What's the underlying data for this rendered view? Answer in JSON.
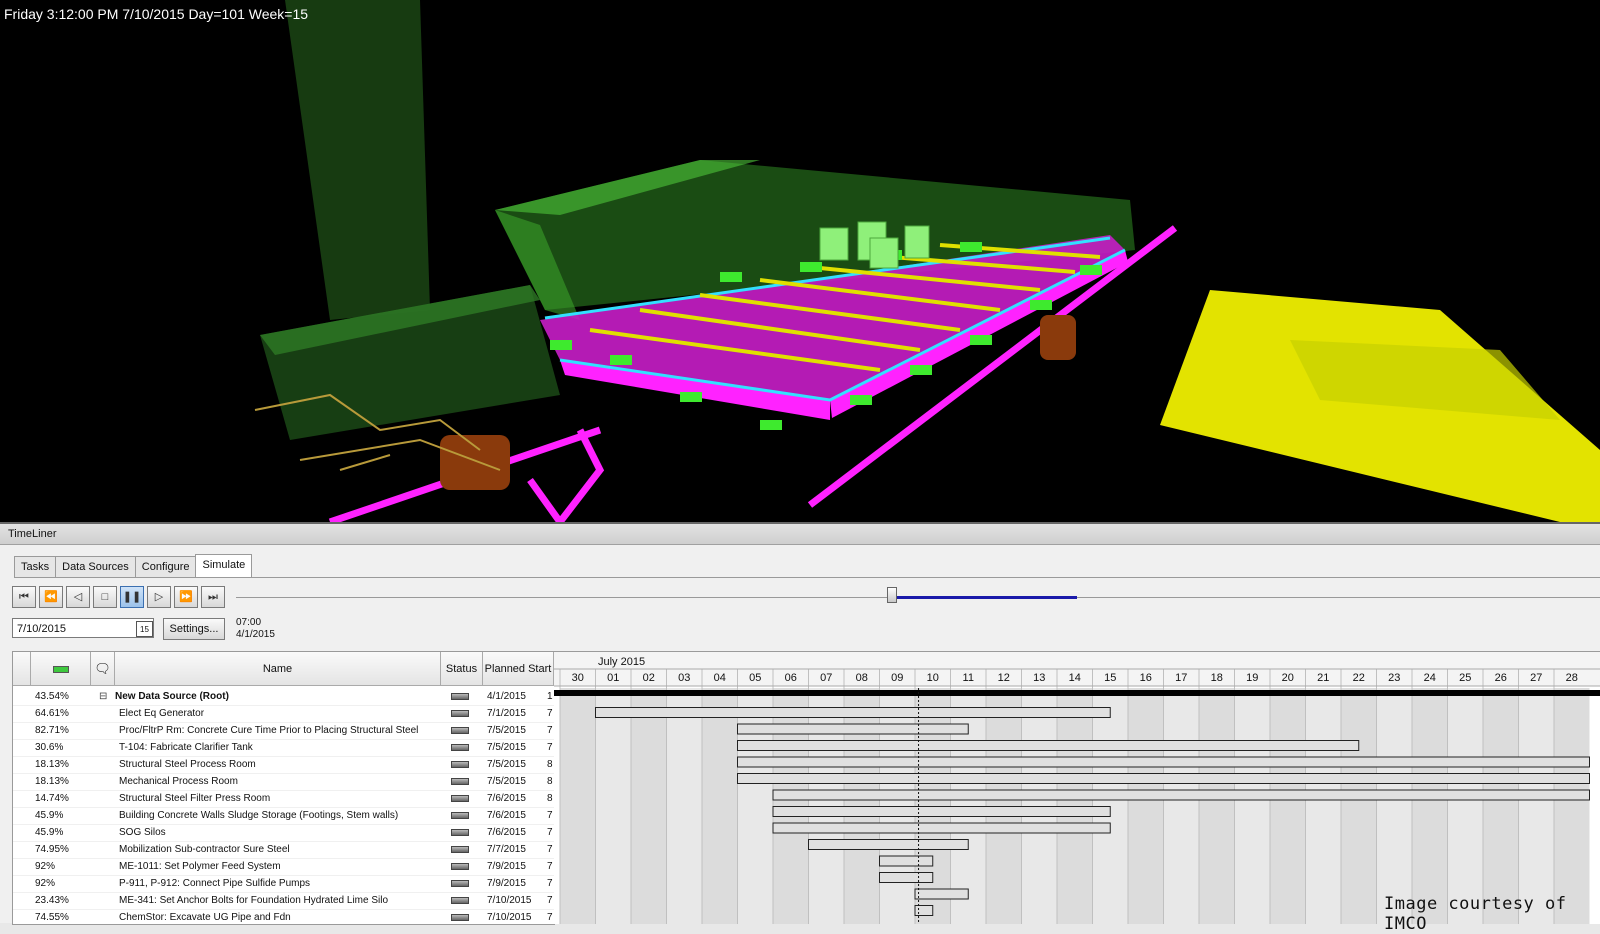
{
  "viewport": {
    "status_text": "Friday 3:12:00 PM 7/10/2015 Day=101 Week=15"
  },
  "timeliner": {
    "title": "TimeLiner",
    "tabs": [
      {
        "label": "Tasks",
        "active": false
      },
      {
        "label": "Data Sources",
        "active": false
      },
      {
        "label": "Configure",
        "active": false
      },
      {
        "label": "Simulate",
        "active": true
      }
    ],
    "playback": {
      "buttons": [
        "rewind-to-start-icon",
        "step-back-icon",
        "play-backward-icon",
        "stop-icon",
        "pause-icon",
        "play-icon",
        "step-forward-icon",
        "forward-to-end-icon"
      ],
      "active_button": "pause-icon",
      "slider_position": 0.48
    },
    "date_value": "7/10/2015",
    "calendar_icon_text": "15",
    "settings_label": "Settings...",
    "time_display": "07:00",
    "date_display": "4/1/2015",
    "columns": {
      "status_col_header": "Status",
      "name_header": "Name",
      "planned_start_header": "Planned Start"
    },
    "tasks": [
      {
        "percent": "43.54%",
        "name": "New Data Source (Root)",
        "planned_start": "4/1/2015",
        "extra": "1",
        "root": true
      },
      {
        "percent": "64.61%",
        "name": "Elect Eq  Generator",
        "planned_start": "7/1/2015",
        "extra": "7"
      },
      {
        "percent": "82.71%",
        "name": "Proc/FltrP Rm: Concrete Cure Time Prior to Placing Structural Steel",
        "planned_start": "7/5/2015",
        "extra": "7"
      },
      {
        "percent": "30.6%",
        "name": "T-104: Fabricate Clarifier Tank",
        "planned_start": "7/5/2015",
        "extra": "7"
      },
      {
        "percent": "18.13%",
        "name": "Structural Steel Process Room",
        "planned_start": "7/5/2015",
        "extra": "8"
      },
      {
        "percent": "18.13%",
        "name": "Mechanical  Process Room",
        "planned_start": "7/5/2015",
        "extra": "8"
      },
      {
        "percent": "14.74%",
        "name": "Structural Steel Filter Press Room",
        "planned_start": "7/6/2015",
        "extra": "8"
      },
      {
        "percent": "45.9%",
        "name": "Building Concrete Walls Sludge Storage (Footings, Stem walls)",
        "planned_start": "7/6/2015",
        "extra": "7"
      },
      {
        "percent": "45.9%",
        "name": "SOG Silos",
        "planned_start": "7/6/2015",
        "extra": "7"
      },
      {
        "percent": "74.95%",
        "name": "Mobilization Sub-contractor Sure Steel",
        "planned_start": "7/7/2015",
        "extra": "7"
      },
      {
        "percent": "92%",
        "name": "ME-1011: Set Polymer Feed System",
        "planned_start": "7/9/2015",
        "extra": "7"
      },
      {
        "percent": "92%",
        "name": "P-911, P-912: Connect Pipe Sulfide Pumps",
        "planned_start": "7/9/2015",
        "extra": "7"
      },
      {
        "percent": "23.43%",
        "name": "ME-341: Set Anchor Bolts for Foundation Hydrated Lime Silo",
        "planned_start": "7/10/2015",
        "extra": "7"
      },
      {
        "percent": "74.55%",
        "name": "ChemStor: Excavate UG Pipe and Fdn",
        "planned_start": "7/10/2015",
        "extra": "7"
      }
    ],
    "gantt": {
      "month_label": "July 2015",
      "days": [
        "30",
        "01",
        "02",
        "03",
        "04",
        "05",
        "06",
        "07",
        "08",
        "09",
        "10",
        "11",
        "12",
        "13",
        "14",
        "15",
        "16",
        "17",
        "18",
        "19",
        "20",
        "21",
        "22",
        "23",
        "24",
        "25",
        "26",
        "27",
        "28"
      ],
      "current_day": "10",
      "bars": [
        {
          "start": 1,
          "end": 15.5
        },
        {
          "start": 5,
          "end": 11.5
        },
        {
          "start": 5,
          "end": 22.5
        },
        {
          "start": 5,
          "end": 29
        },
        {
          "start": 5,
          "end": 29
        },
        {
          "start": 6,
          "end": 29
        },
        {
          "start": 6,
          "end": 15.5
        },
        {
          "start": 6,
          "end": 15.5
        },
        {
          "start": 7,
          "end": 11.5
        },
        {
          "start": 9,
          "end": 10.5
        },
        {
          "start": 9,
          "end": 10.5
        },
        {
          "start": 10,
          "end": 11.5
        },
        {
          "start": 10,
          "end": 10.5
        }
      ]
    }
  },
  "credit": "Image courtesy of IMCO"
}
